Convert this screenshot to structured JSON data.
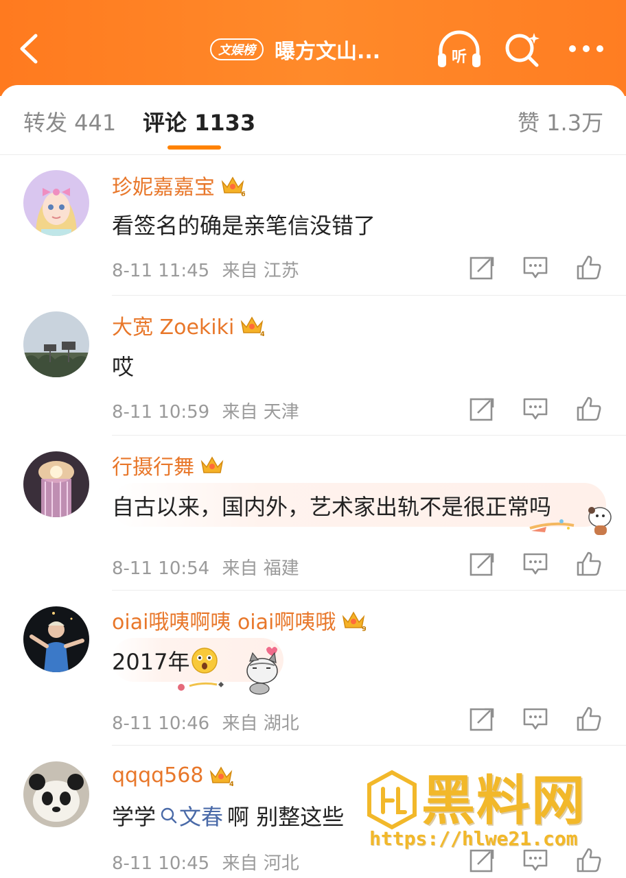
{
  "header": {
    "board_badge": "文娱榜",
    "title": "曝方文山...",
    "listen_label": "听"
  },
  "tabs": [
    {
      "label": "转发 441"
    },
    {
      "label": "评论 1133"
    },
    {
      "label": "赞 1.3万"
    }
  ],
  "comments": [
    {
      "username": "珍妮嘉嘉宝",
      "crown_level": "6",
      "text": "看签名的确是亲笔信没错了",
      "time": "8-11 11:45",
      "location": "来自 江苏"
    },
    {
      "username": "大宽 Zoekiki",
      "crown_level": "4",
      "text": "哎",
      "time": "8-11 10:59",
      "location": "来自 天津"
    },
    {
      "username": "行摄行舞",
      "crown_level": "",
      "text": "自古以来，国内外，艺术家出轨不是很正常吗",
      "time": "8-11 10:54",
      "location": "来自 福建"
    },
    {
      "username": "oiai哦咦啊咦 oiai啊咦哦",
      "crown_level": "9",
      "text": "2017年",
      "time": "8-11 10:46",
      "location": "来自 湖北"
    },
    {
      "username": "qqqq568",
      "crown_level": "4",
      "text_before": "学学",
      "topic": "文春",
      "text_after": "啊 别整这些",
      "time": "8-11 10:45",
      "location": "来自 河北"
    }
  ],
  "watermark": {
    "text": "黑料网",
    "url": "https://hlwe21.com"
  },
  "colors": {
    "header_orange": "#ff7a1f",
    "username": "#e8772a",
    "tab_underline": "#ff8200",
    "topic_link": "#4a6aa8"
  }
}
